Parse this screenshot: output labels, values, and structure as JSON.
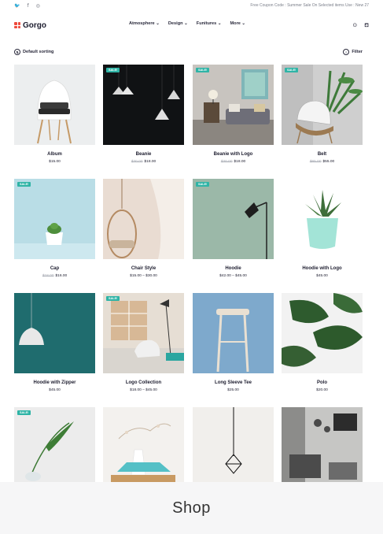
{
  "topbar": {
    "social_icons": [
      "twitter-icon",
      "facebook-icon",
      "instagram-icon"
    ],
    "promo": "Free Coupon Code : Summer Sale On Selected items Use : New 27"
  },
  "header": {
    "logo_text": "Gorgo",
    "nav": [
      "Atmosphere ⌄",
      "Design ⌄",
      "Funitures ⌄",
      "More ⌄"
    ],
    "icons": [
      "account-icon",
      "cart-icon"
    ]
  },
  "toolbar": {
    "sort_label": "Default sorting",
    "filter_label": "Filter"
  },
  "sale_badge": "SALE!",
  "products": [
    {
      "name": "Album",
      "old_price": "",
      "price": "$15.00",
      "sale": false
    },
    {
      "name": "Beanie",
      "old_price": "$20.00",
      "price": "$18.00",
      "sale": true
    },
    {
      "name": "Beanie with Logo",
      "old_price": "$20.00",
      "price": "$18.00",
      "sale": true
    },
    {
      "name": "Belt",
      "old_price": "$65.00",
      "price": "$55.00",
      "sale": true
    },
    {
      "name": "Cap",
      "old_price": "$18.00",
      "price": "$16.00",
      "sale": true
    },
    {
      "name": "Chair Style",
      "old_price": "",
      "price": "$15.00 – $30.00",
      "sale": false
    },
    {
      "name": "Hoodie",
      "old_price": "",
      "price": "$42.00 – $45.00",
      "sale": true
    },
    {
      "name": "Hoodie with Logo",
      "old_price": "",
      "price": "$45.00",
      "sale": false
    },
    {
      "name": "Hoodie with Zipper",
      "old_price": "",
      "price": "$45.00",
      "sale": false
    },
    {
      "name": "Logo Collection",
      "old_price": "",
      "price": "$18.00 – $45.00",
      "sale": true
    },
    {
      "name": "Long Sleeve Tee",
      "old_price": "",
      "price": "$25.00",
      "sale": false
    },
    {
      "name": "Polo",
      "old_price": "",
      "price": "$20.00",
      "sale": false
    },
    {
      "name": "",
      "old_price": "",
      "price": "",
      "sale": true
    },
    {
      "name": "",
      "old_price": "",
      "price": "",
      "sale": false
    },
    {
      "name": "",
      "old_price": "",
      "price": "",
      "sale": false
    },
    {
      "name": "",
      "old_price": "",
      "price": "",
      "sale": false
    }
  ],
  "caption": "Shop"
}
